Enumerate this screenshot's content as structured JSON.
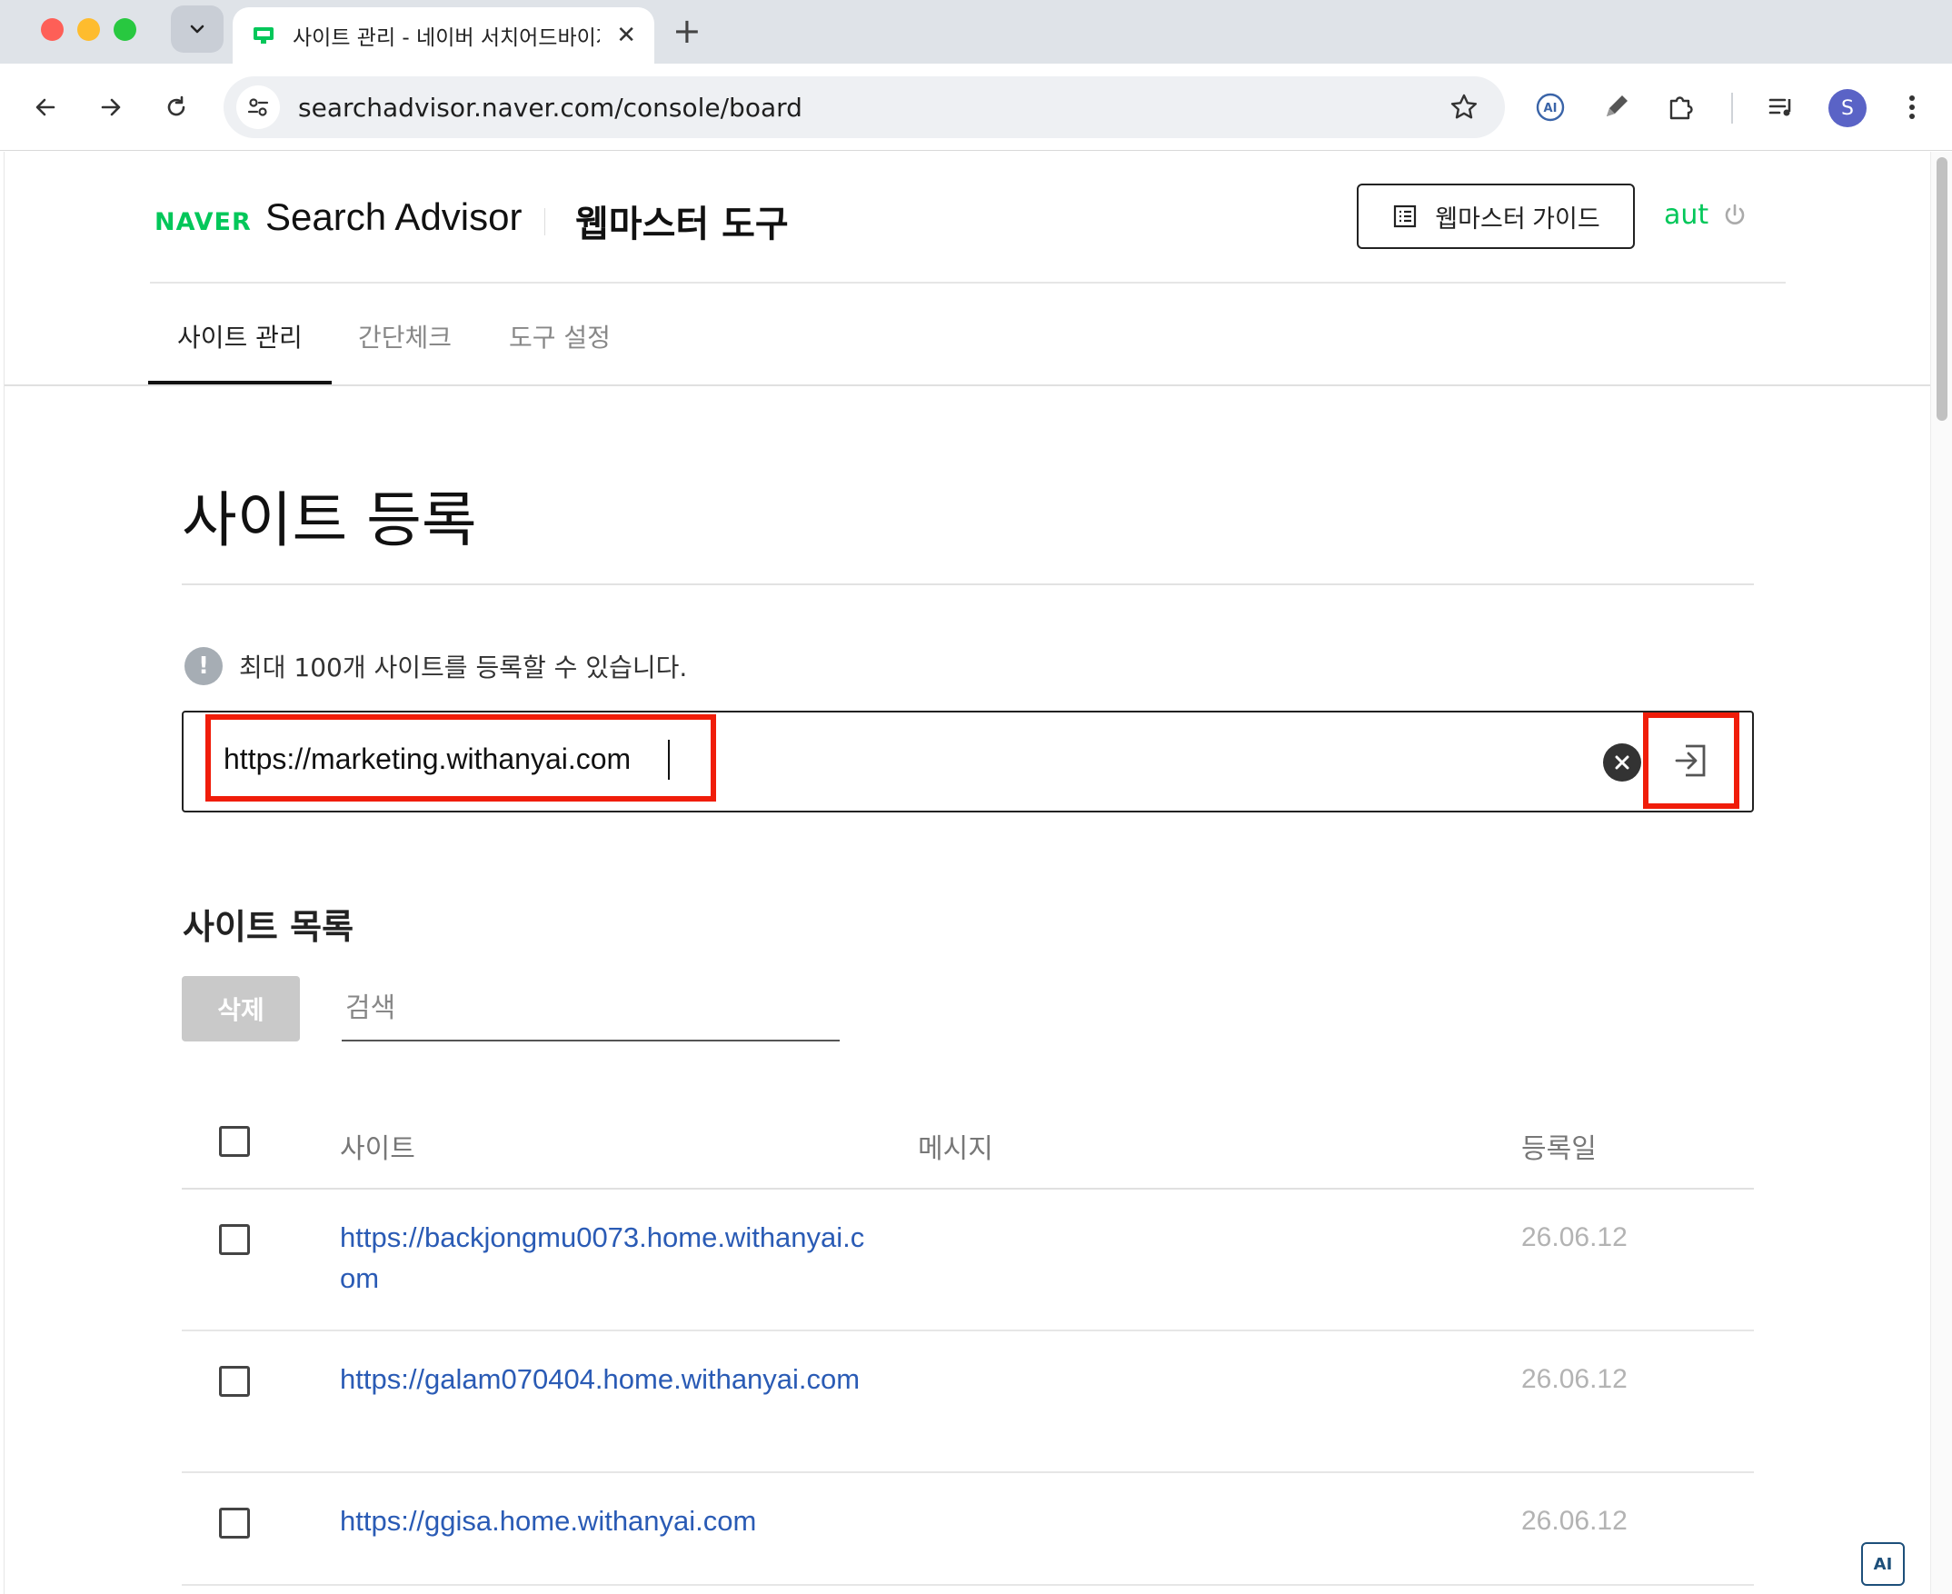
{
  "browser": {
    "tab_title": "사이트 관리 - 네이버 서치어드바이저",
    "url": "searchadvisor.naver.com/console/board",
    "profile_initial": "S",
    "new_tab_symbol": "+",
    "close_symbol": "✕"
  },
  "header": {
    "logo": "NAVER",
    "brand": "Search Advisor",
    "tool_name": "웹마스터 도구",
    "guide_button": "웹마스터 가이드",
    "user": "aut"
  },
  "nav": {
    "tabs": [
      {
        "label": "사이트 관리",
        "active": true
      },
      {
        "label": "간단체크",
        "active": false
      },
      {
        "label": "도구 설정",
        "active": false
      }
    ]
  },
  "main": {
    "title": "사이트 등록",
    "notice_icon": "!",
    "notice": "최대 100개 사이트를 등록할 수 있습니다.",
    "url_input_value": "https://marketing.withanyai.com",
    "list_title": "사이트 목록",
    "delete_button": "삭제",
    "search_placeholder": "검색",
    "table": {
      "headers": {
        "site": "사이트",
        "message": "메시지",
        "date": "등록일"
      },
      "rows": [
        {
          "site": "https://backjongmu0073.home.withanyai.com",
          "message": "",
          "date": "26.06.12"
        },
        {
          "site": "https://galam070404.home.withanyai.com",
          "message": "",
          "date": "26.06.12"
        },
        {
          "site": "https://ggisa.home.withanyai.com",
          "message": "",
          "date": "26.06.12"
        }
      ]
    }
  },
  "colors": {
    "naver_green": "#03c75a",
    "highlight_red": "#f01d0a",
    "link_blue": "#2a5bb5"
  },
  "icons": [
    "chevron-down-icon",
    "tab-favicon-icon",
    "back-arrow-icon",
    "forward-arrow-icon",
    "reload-icon",
    "site-info-icon",
    "bookmark-star-icon",
    "ai-extension-icon",
    "pen-extension-icon",
    "puzzle-extension-icon",
    "media-queue-icon",
    "more-vertical-icon",
    "guide-list-icon",
    "power-icon",
    "alert-icon",
    "clear-icon",
    "submit-arrow-icon",
    "ai-badge-icon"
  ],
  "ai_badge": "AI"
}
